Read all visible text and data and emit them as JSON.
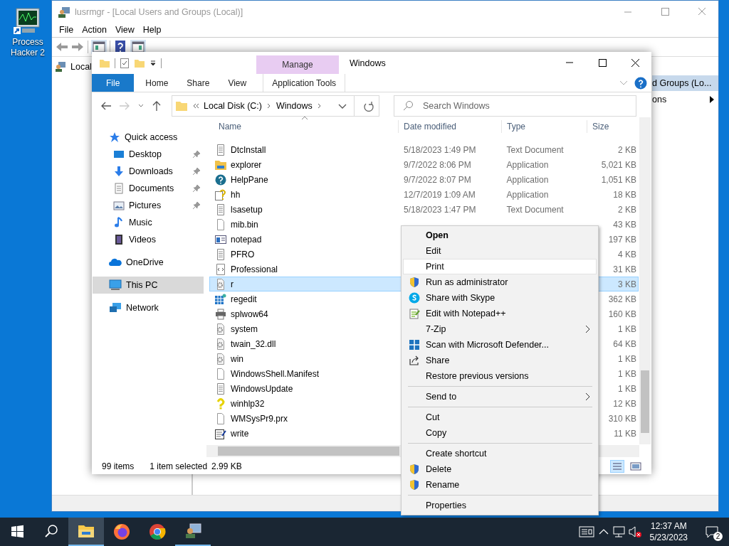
{
  "desktop": {
    "icons": [
      {
        "label": "Process Hacker 2"
      }
    ]
  },
  "mmc": {
    "title": "lusrmgr - [Local Users and Groups (Local)]",
    "menu": [
      "File",
      "Action",
      "View",
      "Help"
    ],
    "tree": [
      {
        "label": "Local",
        "selected": false
      }
    ],
    "actions": {
      "header": "d Groups (Lo...",
      "items": [
        {
          "label": "ons",
          "submenu": true
        }
      ]
    }
  },
  "explorer": {
    "title": "Windows",
    "context_tab": "Manage",
    "tabs": [
      {
        "label": "File",
        "kind": "file"
      },
      {
        "label": "Home",
        "kind": "tab"
      },
      {
        "label": "Share",
        "kind": "tab"
      },
      {
        "label": "View",
        "kind": "tab"
      },
      {
        "label": "Application Tools",
        "kind": "context"
      }
    ],
    "path": [
      "Local Disk (C:)",
      "Windows"
    ],
    "search": {
      "placeholder": "Search Windows"
    },
    "nav": [
      {
        "label": "Quick access",
        "kind": "star",
        "selected": false,
        "children": [
          {
            "label": "Desktop",
            "kind": "desktop",
            "pinned": true,
            "selected": false
          },
          {
            "label": "Downloads",
            "kind": "download",
            "pinned": true,
            "selected": false
          },
          {
            "label": "Documents",
            "kind": "documents",
            "pinned": true,
            "selected": false
          },
          {
            "label": "Pictures",
            "kind": "pictures",
            "pinned": true,
            "selected": false
          },
          {
            "label": "Music",
            "kind": "music",
            "pinned": false,
            "selected": false
          },
          {
            "label": "Videos",
            "kind": "videos",
            "pinned": false,
            "selected": false
          }
        ]
      },
      {
        "label": "OneDrive",
        "kind": "cloud",
        "selected": false
      },
      {
        "label": "This PC",
        "kind": "pc",
        "selected": true
      },
      {
        "label": "Network",
        "kind": "network",
        "selected": false
      }
    ],
    "columns": [
      "Name",
      "Date modified",
      "Type",
      "Size"
    ],
    "rows": [
      {
        "name": "DtcInstall",
        "kind": "text",
        "date": "5/18/2023 1:49 PM",
        "type": "Text Document",
        "size": "2 KB",
        "selected": false
      },
      {
        "name": "explorer",
        "kind": "folder",
        "date": "9/7/2022 8:06 PM",
        "type": "Application",
        "size": "5,021 KB",
        "selected": false
      },
      {
        "name": "HelpPane",
        "kind": "help",
        "date": "9/7/2022 8:07 PM",
        "type": "Application",
        "size": "1,051 KB",
        "selected": false
      },
      {
        "name": "hh",
        "kind": "helpdoc",
        "date": "12/7/2019 1:09 AM",
        "type": "Application",
        "size": "18 KB",
        "selected": false
      },
      {
        "name": "lsasetup",
        "kind": "text",
        "date": "5/18/2023 1:47 PM",
        "type": "Text Document",
        "size": "2 KB",
        "selected": false
      },
      {
        "name": "mib.bin",
        "kind": "blank",
        "size": "43 KB",
        "selected": false
      },
      {
        "name": "notepad",
        "kind": "window",
        "size": "197 KB",
        "selected": false
      },
      {
        "name": "PFRO",
        "kind": "text",
        "size": "4 KB",
        "selected": false
      },
      {
        "name": "Professional",
        "kind": "code",
        "size": "31 KB",
        "selected": false
      },
      {
        "name": "r",
        "kind": "gear",
        "size": "3 KB",
        "selected": true
      },
      {
        "name": "regedit",
        "kind": "grid",
        "size": "362 KB",
        "selected": false
      },
      {
        "name": "splwow64",
        "kind": "printer",
        "size": "160 KB",
        "selected": false
      },
      {
        "name": "system",
        "kind": "gear",
        "size": "1 KB",
        "selected": false
      },
      {
        "name": "twain_32.dll",
        "kind": "gear",
        "size": "64 KB",
        "selected": false
      },
      {
        "name": "win",
        "kind": "gear",
        "size": "1 KB",
        "selected": false
      },
      {
        "name": "WindowsShell.Manifest",
        "kind": "blank",
        "size": "1 KB",
        "selected": false
      },
      {
        "name": "WindowsUpdate",
        "kind": "text",
        "size": "1 KB",
        "selected": false
      },
      {
        "name": "winhlp32",
        "kind": "question",
        "size": "12 KB",
        "selected": false
      },
      {
        "name": "WMSysPr9.prx",
        "kind": "blank",
        "size": "310 KB",
        "selected": false
      },
      {
        "name": "write",
        "kind": "write",
        "size": "11 KB",
        "selected": false
      }
    ],
    "status": {
      "count": "99 items",
      "selection": "1 item selected",
      "size": "2.99 KB"
    }
  },
  "context_menu": {
    "groups": [
      [
        {
          "label": "Open",
          "kind": "plain",
          "default": true,
          "hovered": false
        },
        {
          "label": "Edit",
          "kind": "plain",
          "default": false,
          "hovered": false
        },
        {
          "label": "Print",
          "kind": "plain",
          "default": false,
          "hovered": true
        },
        {
          "label": "Run as administrator",
          "kind": "shield",
          "default": false,
          "hovered": false
        },
        {
          "label": "Share with Skype",
          "kind": "skype",
          "default": false,
          "hovered": false
        },
        {
          "label": "Edit with Notepad++",
          "kind": "notepad",
          "default": false,
          "hovered": false
        },
        {
          "label": "7-Zip",
          "kind": "plain",
          "submenu": true,
          "default": false,
          "hovered": false
        },
        {
          "label": "Scan with Microsoft Defender...",
          "kind": "defender",
          "default": false,
          "hovered": false
        },
        {
          "label": "Share",
          "kind": "share",
          "default": false,
          "hovered": false
        },
        {
          "label": "Restore previous versions",
          "kind": "plain",
          "default": false,
          "hovered": false
        }
      ],
      [
        {
          "label": "Send to",
          "kind": "plain",
          "submenu": true,
          "default": false,
          "hovered": false
        }
      ],
      [
        {
          "label": "Cut",
          "kind": "plain",
          "default": false,
          "hovered": false
        },
        {
          "label": "Copy",
          "kind": "plain",
          "default": false,
          "hovered": false
        }
      ],
      [
        {
          "label": "Create shortcut",
          "kind": "plain",
          "default": false,
          "hovered": false
        },
        {
          "label": "Delete",
          "kind": "shield",
          "default": false,
          "hovered": false
        },
        {
          "label": "Rename",
          "kind": "shield",
          "default": false,
          "hovered": false
        }
      ],
      [
        {
          "label": "Properties",
          "kind": "plain",
          "default": false,
          "hovered": false
        }
      ]
    ]
  },
  "taskbar": {
    "apps": [
      {
        "kind": "explorer",
        "active": true,
        "running": true
      },
      {
        "kind": "firefox",
        "active": false,
        "running": false
      },
      {
        "kind": "chrome",
        "active": false,
        "running": false
      },
      {
        "kind": "mmc",
        "active": false,
        "running": true
      }
    ],
    "clock": {
      "time": "12:37 AM",
      "date": "5/23/2023"
    },
    "notifications": "2"
  }
}
